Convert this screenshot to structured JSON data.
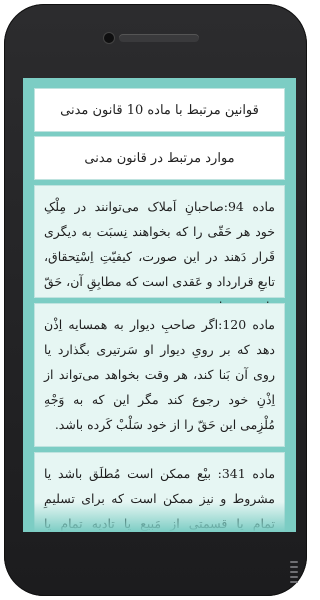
{
  "cards": {
    "title": "قوانین مرتبط با ماده 10 قانون مدنی",
    "subtitle": "موارد مرتبط در قانون مدنی"
  },
  "articles": [
    {
      "text": "ماده 94:صاحبانِ اَملاک می‌توانند در مِلْکِ خود هر حَقّی را که بخواهند نِسبَت به دیگری قَرار دَهند در این صورت، کیفیّتِ اِسْتِحقاق، تابعِ قرارداد و عَقدی است که مطابِقِ آن، حَقّ داده شده است."
    },
    {
      "text": "ماده 120:اگر صاحبِ دیوار به همسایه اِذْن دهد که بر رویِ دیوار او سَرتیری بگذارد یا روی آن بَنا کند، هر وقت بخواهد می‌تواند از اِذْنِ خود رجوع کند مگر این که به وَجْهِ مُلْزِمی این حَقّ را از خود سَلْبْ کَرده باشد."
    },
    {
      "text": "ماده 341: بیْع ممکن است مُطلَق باشد یا مشروط و نیز ممکن است که برای تسلیمِ تمام یا قسمتی از مَبیع یا تادیه تمام یا قسمتی از ثَمَن اَجَلی قرار داده شود."
    }
  ]
}
